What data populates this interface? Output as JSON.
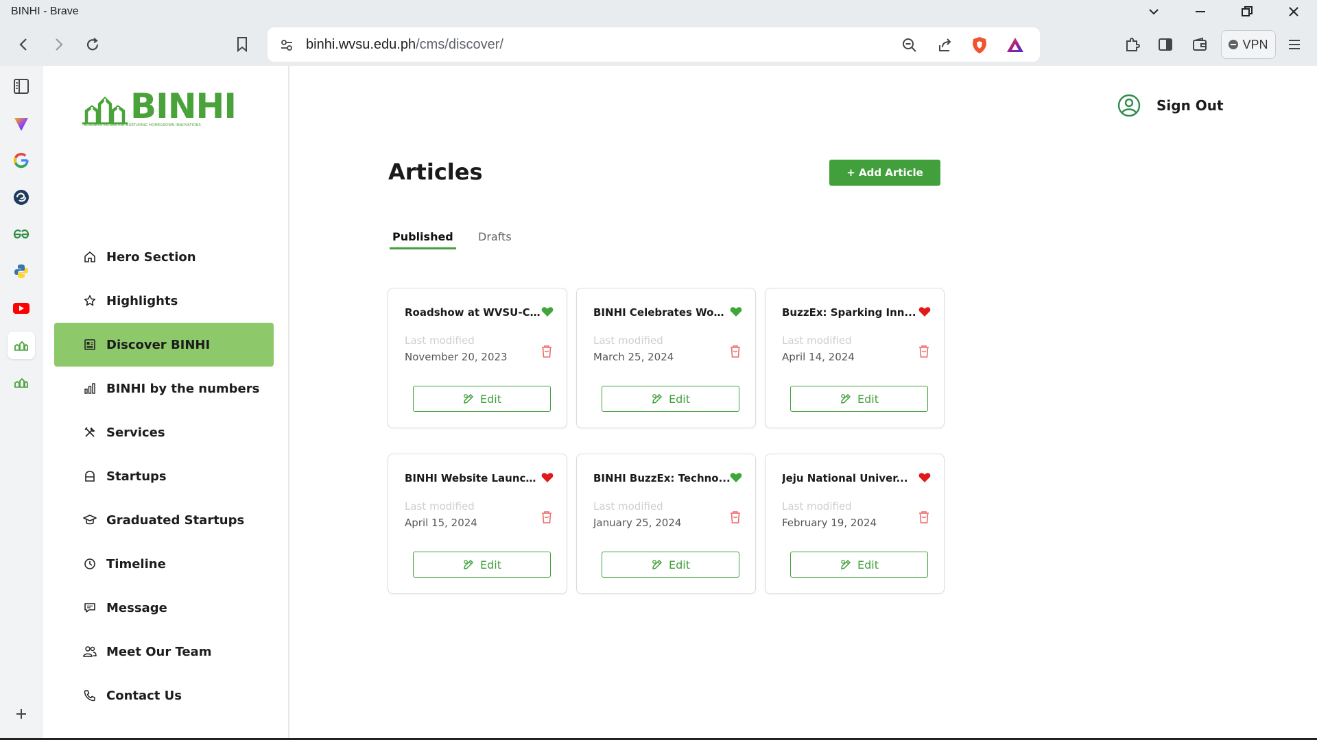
{
  "browser": {
    "window_title": "BINHI - Brave",
    "url_host": "binhi.wvsu.edu.ph",
    "url_path": "/cms/discover/",
    "vpn_label": "VPN"
  },
  "brand": {
    "logo_word": "BINHI",
    "logo_tagline": "BUSINESS INCUBATOR NURTURING HOMEGROWN INNOVATIONS",
    "accent": "#41a03c",
    "active_nav_bg": "#8dc96a"
  },
  "sidebar": {
    "items": [
      {
        "label": "Hero Section",
        "icon": "home-icon"
      },
      {
        "label": "Highlights",
        "icon": "star-icon"
      },
      {
        "label": "Discover BINHI",
        "icon": "newspaper-icon",
        "active": true
      },
      {
        "label": "BINHI by the numbers",
        "icon": "bar-chart-icon"
      },
      {
        "label": "Services",
        "icon": "tools-icon"
      },
      {
        "label": "Startups",
        "icon": "startup-icon"
      },
      {
        "label": "Graduated Startups",
        "icon": "graduation-cap-icon"
      },
      {
        "label": "Timeline",
        "icon": "clock-icon"
      },
      {
        "label": "Message",
        "icon": "message-icon"
      },
      {
        "label": "Meet Our Team",
        "icon": "team-icon"
      },
      {
        "label": "Contact Us",
        "icon": "phone-icon"
      }
    ]
  },
  "header": {
    "sign_out": "Sign Out"
  },
  "main": {
    "title": "Articles",
    "add_button": "+ Add Article",
    "tabs": [
      "Published",
      "Drafts"
    ],
    "last_modified_label": "Last modified",
    "edit_label": "Edit",
    "articles": [
      {
        "title": "Roadshow at WVSU-Cal...",
        "date": "November 20, 2023",
        "heart_color": "#3fa63a"
      },
      {
        "title": "BINHI Celebrates Wom...",
        "date": "March 25, 2024",
        "heart_color": "#3fa63a"
      },
      {
        "title": "BuzzEx: Sparking Inn...",
        "date": "April 14, 2024",
        "heart_color": "#e01919"
      },
      {
        "title": "BINHI Website Launch...",
        "date": "April 15, 2024",
        "heart_color": "#e01919"
      },
      {
        "title": "BINHI BuzzEx: Techno...",
        "date": "January 25, 2024",
        "heart_color": "#3fa63a"
      },
      {
        "title": "Jeju National Univer...",
        "date": "February 19, 2024",
        "heart_color": "#e01919"
      }
    ]
  }
}
